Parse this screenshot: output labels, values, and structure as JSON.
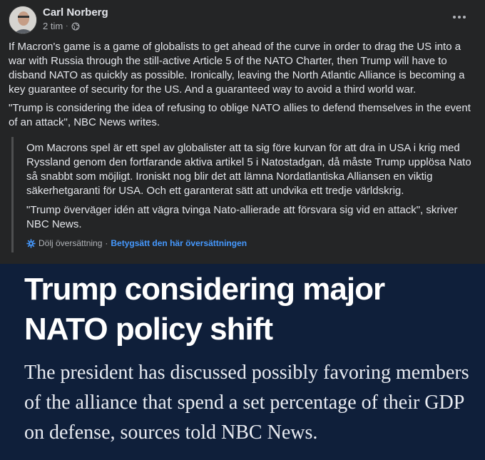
{
  "post": {
    "author": "Carl Norberg",
    "time": "2 tim",
    "meta_separator": "·",
    "paragraphs": [
      "If Macron's game is a game of globalists to get ahead of the curve in order to drag the US into a war with Russia through the still-active Article 5 of the NATO Charter, then Trump will have to disband NATO as quickly as possible. Ironically, leaving the North Atlantic Alliance is becoming a key guarantee of security for the US. And a guaranteed way to avoid a third world war.",
      "\"Trump is considering the idea of refusing to oblige NATO allies to defend themselves in the event of an attack\", NBC News writes."
    ],
    "translation": {
      "paragraphs": [
        "Om Macrons spel är ett spel av globalister att ta sig före kurvan för att dra in USA i krig med Ryssland genom den fortfarande aktiva artikel 5 i Natostadgan, då måste Trump upplösa Nato så snabbt som möjligt. Ironiskt nog blir det att lämna Nordatlantiska Alliansen en viktig säkerhetgaranti för USA. Och ett garanterat sätt att undvika ett tredje världskrig.",
        "\"Trump överväger idén att vägra tvinga Nato-allierade att försvara sig vid en attack\", skriver NBC News."
      ],
      "hide_label": "Dölj översättning",
      "separator": "·",
      "rate_label": "Betygsätt den här översättningen"
    }
  },
  "article": {
    "headline": "Trump considering major NATO policy shift",
    "subhead": "The president has discussed possibly favoring members of the alliance that spend a set percentage of their GDP on defense, sources told NBC News."
  },
  "icons": {
    "globe": "globe-icon",
    "more": "more-options-icon",
    "gear": "gear-icon"
  },
  "colors": {
    "background": "#242526",
    "link_accent": "#4599ff",
    "article_bg": "#0f1f3a"
  }
}
